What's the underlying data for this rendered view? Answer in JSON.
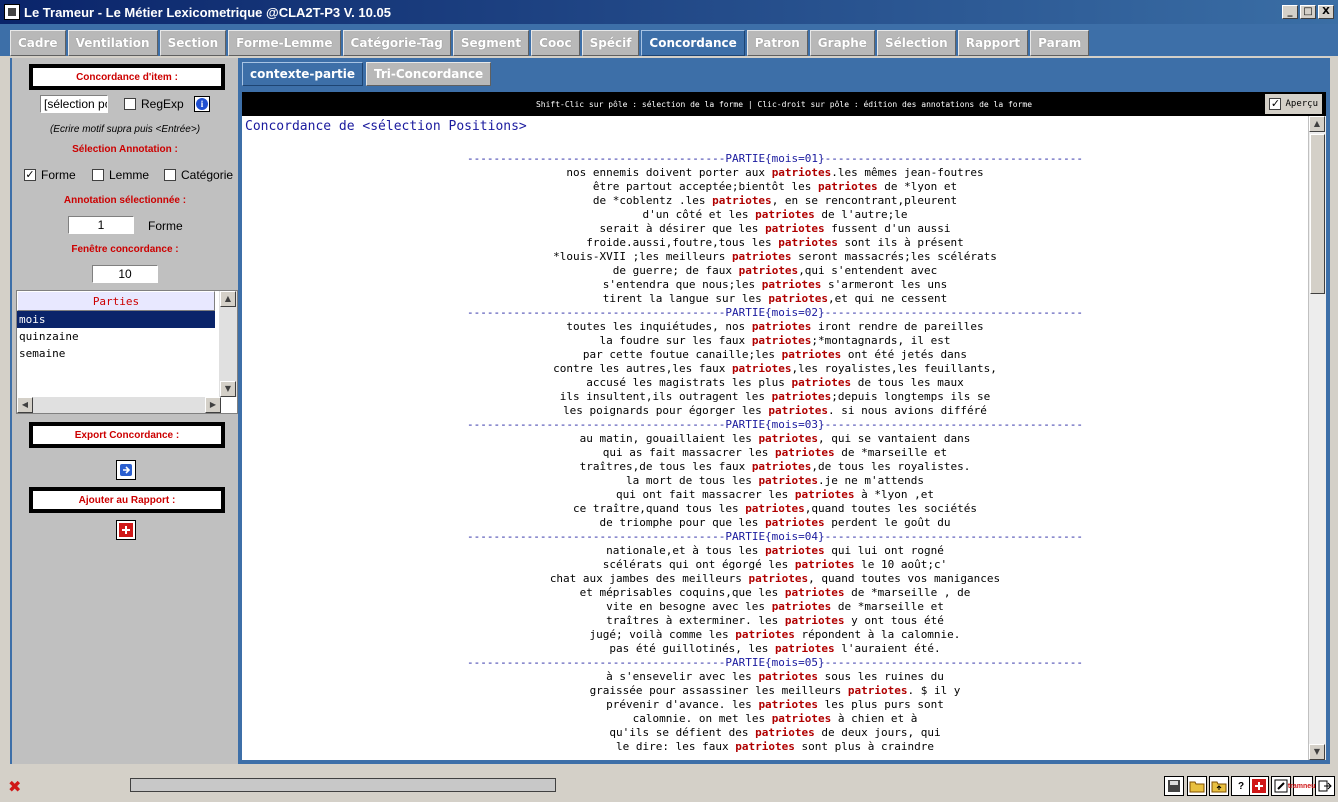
{
  "window": {
    "title": "Le Trameur - Le Métier Lexicometrique @CLA2T-P3 V. 10.05",
    "minimize": "_",
    "maximize": "□",
    "close": "X"
  },
  "main_tabs": [
    {
      "label": "Cadre",
      "active": false
    },
    {
      "label": "Ventilation",
      "active": false
    },
    {
      "label": "Section",
      "active": false
    },
    {
      "label": "Forme-Lemme",
      "active": false
    },
    {
      "label": "Catégorie-Tag",
      "active": false
    },
    {
      "label": "Segment",
      "active": false
    },
    {
      "label": "Cooc",
      "active": false
    },
    {
      "label": "Spécif",
      "active": false
    },
    {
      "label": "Concordance",
      "active": true
    },
    {
      "label": "Patron",
      "active": false
    },
    {
      "label": "Graphe",
      "active": false
    },
    {
      "label": "Sélection",
      "active": false
    },
    {
      "label": "Rapport",
      "active": false
    },
    {
      "label": "Param",
      "active": false
    }
  ],
  "left": {
    "item_box": "Concordance d'item :",
    "motif_value": "[sélection po",
    "regexp_label": "RegExp",
    "regexp_checked": false,
    "info_icon": "i",
    "hint": "(Ecrire motif supra puis <Entrée>)",
    "annotation_title": "Sélection Annotation :",
    "forme_label": "Forme",
    "forme_checked": true,
    "lemme_label": "Lemme",
    "lemme_checked": false,
    "categorie_label": "Catégorie",
    "categorie_checked": false,
    "selected_title": "Annotation sélectionnée :",
    "selected_value": "1",
    "selected_kind": "Forme",
    "window_title": "Fenêtre concordance :",
    "window_value": "10",
    "parts_header": "Parties",
    "parts": [
      {
        "label": "mois",
        "selected": true
      },
      {
        "label": "quinzaine",
        "selected": false
      },
      {
        "label": "semaine",
        "selected": false
      }
    ],
    "export_box": "Export Concordance :",
    "report_box": "Ajouter au Rapport :"
  },
  "sub_tabs": [
    {
      "label": "contexte-partie",
      "active": true
    },
    {
      "label": "Tri-Concordance",
      "active": false
    }
  ],
  "infobar": "Shift-Clic sur pôle : sélection de la forme | Clic-droit sur pôle : édition des annotations de la forme",
  "apercu_label": "Aperçu",
  "apercu_checked": true,
  "concordance": {
    "title": "Concordance de <sélection Positions>",
    "lines": [
      {
        "type": "part",
        "text": "---------------------------------------PARTIE{mois=01}---------------------------------------"
      },
      {
        "type": "line",
        "left": "nos ennemis doivent porter aux ",
        "pole": "patriotes",
        "right": ".les mêmes jean-foutres"
      },
      {
        "type": "line",
        "left": "être partout acceptée;bientôt les ",
        "pole": "patriotes",
        "right": " de *lyon et"
      },
      {
        "type": "line",
        "left": "de *coblentz .les ",
        "pole": "patriotes",
        "right": ", en se rencontrant,pleurent"
      },
      {
        "type": "line",
        "left": "d'un côté et les ",
        "pole": "patriotes",
        "right": " de l'autre;le"
      },
      {
        "type": "line",
        "left": "serait à désirer que les ",
        "pole": "patriotes",
        "right": " fussent d'un aussi"
      },
      {
        "type": "line",
        "left": "froide.aussi,foutre,tous les ",
        "pole": "patriotes",
        "right": " sont ils à présent"
      },
      {
        "type": "line",
        "left": "*louis-XVII ;les meilleurs ",
        "pole": "patriotes",
        "right": " seront massacrés;les scélérats"
      },
      {
        "type": "line",
        "left": "de guerre; de faux ",
        "pole": "patriotes",
        "right": ",qui s'entendent avec"
      },
      {
        "type": "line",
        "left": "s'entendra que nous;les ",
        "pole": "patriotes",
        "right": " s'armeront les uns"
      },
      {
        "type": "line",
        "left": "tirent la langue sur les ",
        "pole": "patriotes",
        "right": ",et qui ne cessent"
      },
      {
        "type": "part",
        "text": "---------------------------------------PARTIE{mois=02}---------------------------------------"
      },
      {
        "type": "line",
        "left": "toutes les inquiétudes, nos ",
        "pole": "patriotes",
        "right": " iront rendre de pareilles"
      },
      {
        "type": "line",
        "left": "la foudre sur les faux ",
        "pole": "patriotes",
        "right": ";*montagnards, il est"
      },
      {
        "type": "line",
        "left": "par cette foutue canaille;les ",
        "pole": "patriotes",
        "right": " ont été jetés dans"
      },
      {
        "type": "line",
        "left": "contre les autres,les faux ",
        "pole": "patriotes",
        "right": ",les royalistes,les feuillants,"
      },
      {
        "type": "line",
        "left": "accusé les magistrats les plus ",
        "pole": "patriotes",
        "right": " de tous les maux"
      },
      {
        "type": "line",
        "left": "ils insultent,ils outragent les ",
        "pole": "patriotes",
        "right": ";depuis longtemps ils se"
      },
      {
        "type": "line",
        "left": "les poignards pour égorger les ",
        "pole": "patriotes",
        "right": ". si nous avions différé"
      },
      {
        "type": "part",
        "text": "---------------------------------------PARTIE{mois=03}---------------------------------------"
      },
      {
        "type": "line",
        "left": "au matin, gouaillaient les ",
        "pole": "patriotes",
        "right": ", qui se vantaient dans"
      },
      {
        "type": "line",
        "left": "qui as fait massacrer les ",
        "pole": "patriotes",
        "right": " de *marseille et"
      },
      {
        "type": "line",
        "left": "traîtres,de tous les faux ",
        "pole": "patriotes",
        "right": ",de tous les royalistes."
      },
      {
        "type": "line",
        "left": "la mort de tous les ",
        "pole": "patriotes",
        "right": ".je ne m'attends"
      },
      {
        "type": "line",
        "left": "qui ont fait massacrer les ",
        "pole": "patriotes",
        "right": " à *lyon ,et"
      },
      {
        "type": "line",
        "left": "ce traître,quand tous les ",
        "pole": "patriotes",
        "right": ",quand toutes les sociétés"
      },
      {
        "type": "line",
        "left": "de triomphe pour que les ",
        "pole": "patriotes",
        "right": " perdent le goût du"
      },
      {
        "type": "part",
        "text": "---------------------------------------PARTIE{mois=04}---------------------------------------"
      },
      {
        "type": "line",
        "left": "nationale,et à tous les ",
        "pole": "patriotes",
        "right": " qui lui ont rogné"
      },
      {
        "type": "line",
        "left": "scélérats qui ont égorgé les ",
        "pole": "patriotes",
        "right": " le 10 août;c'"
      },
      {
        "type": "line",
        "left": "chat aux jambes des meilleurs ",
        "pole": "patriotes",
        "right": ", quand toutes vos manigances"
      },
      {
        "type": "line",
        "left": "et méprisables coquins,que les ",
        "pole": "patriotes",
        "right": " de *marseille , de"
      },
      {
        "type": "line",
        "left": "vite en besogne avec les ",
        "pole": "patriotes",
        "right": " de *marseille et"
      },
      {
        "type": "line",
        "left": "traîtres à exterminer. les ",
        "pole": "patriotes",
        "right": " y ont tous été"
      },
      {
        "type": "line",
        "left": "jugé; voilà comme les ",
        "pole": "patriotes",
        "right": " répondent à la calomnie."
      },
      {
        "type": "line",
        "left": "pas été guillotinés, les ",
        "pole": "patriotes",
        "right": " l'auraient été."
      },
      {
        "type": "part",
        "text": "---------------------------------------PARTIE{mois=05}---------------------------------------"
      },
      {
        "type": "line",
        "left": "à s'ensevelir avec les ",
        "pole": "patriotes",
        "right": " sous les ruines du"
      },
      {
        "type": "line",
        "left": "graissée pour assassiner les meilleurs ",
        "pole": "patriotes",
        "right": ". $ il y"
      },
      {
        "type": "line",
        "left": "prévenir d'avance. les ",
        "pole": "patriotes",
        "right": " les plus purs sont"
      },
      {
        "type": "line",
        "left": "calomnie. on met les ",
        "pole": "patriotes",
        "right": " à chien et à"
      },
      {
        "type": "line",
        "left": "qu'ils se défient des ",
        "pole": "patriotes",
        "right": " de deux jours, qui"
      },
      {
        "type": "line",
        "left": "le dire: les faux ",
        "pole": "patriotes",
        "right": " sont plus à craindre"
      }
    ]
  },
  "statusbar": {
    "error_icon": "✖",
    "tools": [
      "save-icon",
      "folder-open-icon",
      "folder-up-icon",
      "help-icon",
      "add-icon",
      "edit-icon",
      "trameur-logo",
      "exit-icon"
    ],
    "trameur_logo": "tramneur"
  }
}
